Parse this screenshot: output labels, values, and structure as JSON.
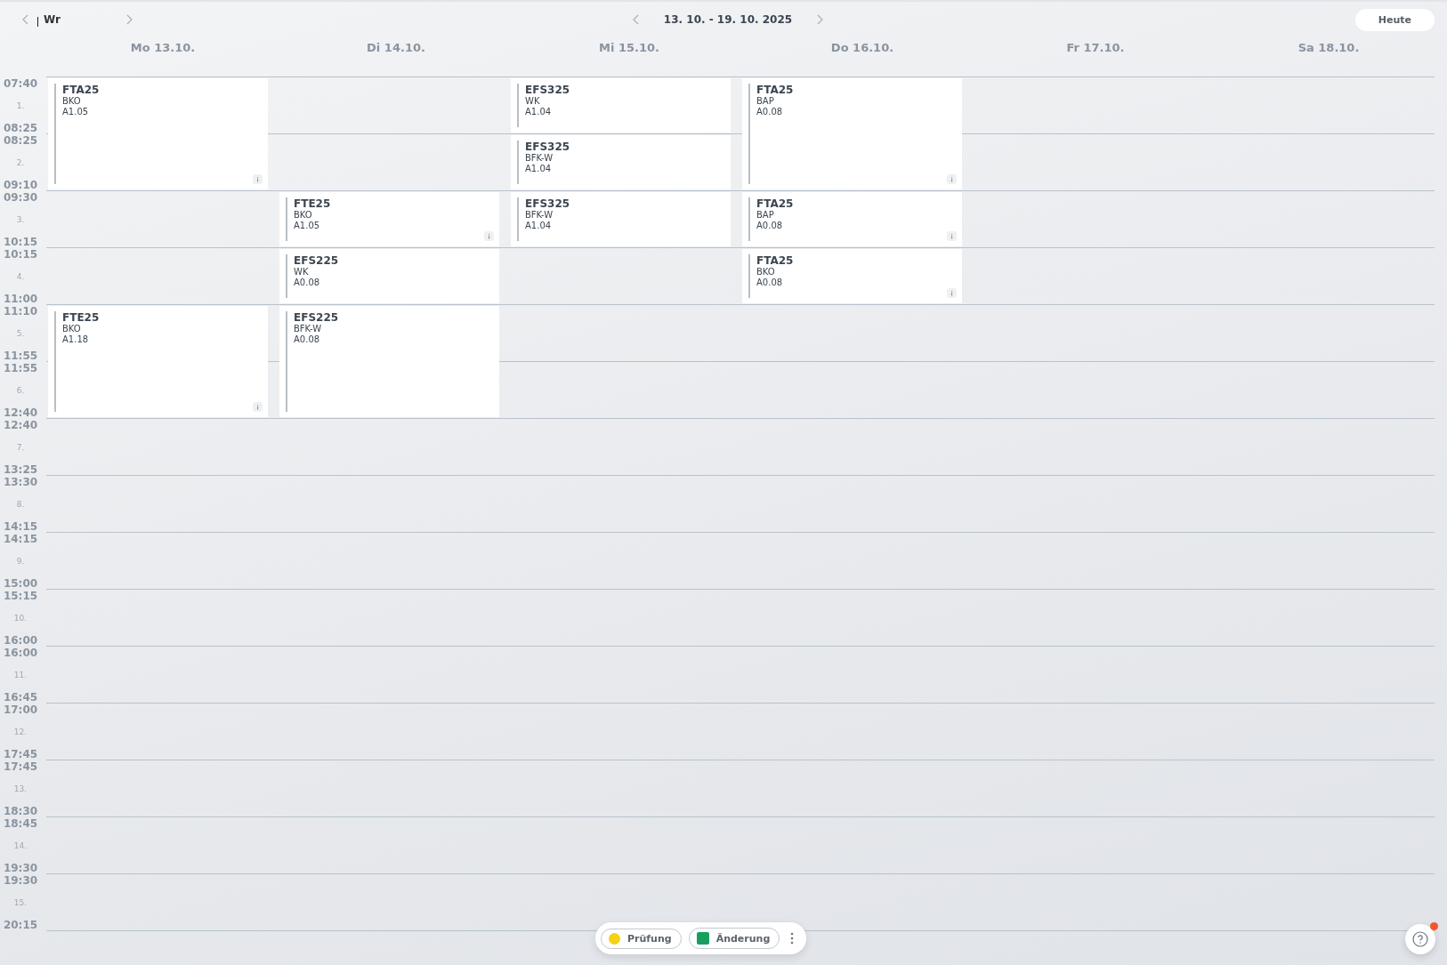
{
  "toolbar": {
    "search": {
      "value": "Wr"
    },
    "week_range": "13. 10. - 19. 10. 2025",
    "today_button": "Heute"
  },
  "time_slots": [
    {
      "number": "1.",
      "start": "07:40",
      "end": "08:25"
    },
    {
      "number": "2.",
      "start": "08:25",
      "end": "09:10"
    },
    {
      "number": "3.",
      "start": "09:30",
      "end": "10:15"
    },
    {
      "number": "4.",
      "start": "10:15",
      "end": "11:00"
    },
    {
      "number": "5.",
      "start": "11:10",
      "end": "11:55"
    },
    {
      "number": "6.",
      "start": "11:55",
      "end": "12:40"
    },
    {
      "number": "7.",
      "start": "12:40",
      "end": "13:25"
    },
    {
      "number": "8.",
      "start": "13:30",
      "end": "14:15"
    },
    {
      "number": "9.",
      "start": "14:15",
      "end": "15:00"
    },
    {
      "number": "10.",
      "start": "15:15",
      "end": "16:00"
    },
    {
      "number": "11.",
      "start": "16:00",
      "end": "16:45"
    },
    {
      "number": "12.",
      "start": "17:00",
      "end": "17:45"
    },
    {
      "number": "13.",
      "start": "17:45",
      "end": "18:30"
    },
    {
      "number": "14.",
      "start": "18:45",
      "end": "19:30"
    },
    {
      "number": "15.",
      "start": "19:30",
      "end": "20:15"
    }
  ],
  "days": [
    {
      "label": "Mo 13.10.",
      "schedule": [
        {
          "kind": "lesson",
          "class": "FTA25",
          "subject": "BKO",
          "room": "A1.05",
          "double": true,
          "has_info": true
        },
        {
          "kind": "free"
        },
        {
          "kind": "free"
        },
        {
          "kind": "lesson",
          "class": "FTE25",
          "subject": "BKO",
          "room": "A1.18",
          "double": true,
          "has_info": true
        }
      ]
    },
    {
      "label": "Di 14.10.",
      "schedule": [
        {
          "kind": "free"
        },
        {
          "kind": "free"
        },
        {
          "kind": "lesson",
          "class": "FTE25",
          "subject": "BKO",
          "room": "A1.05",
          "double": false,
          "has_info": true
        },
        {
          "kind": "lesson",
          "class": "EFS225",
          "subject": "WK",
          "room": "A0.08",
          "double": false,
          "has_info": false
        },
        {
          "kind": "lesson",
          "class": "EFS225",
          "subject": "BFK-W",
          "room": "A0.08",
          "double": true,
          "has_info": false
        }
      ]
    },
    {
      "label": "Mi 15.10.",
      "schedule": [
        {
          "kind": "lesson",
          "class": "EFS325",
          "subject": "WK",
          "room": "A1.04",
          "double": false,
          "has_info": false
        },
        {
          "kind": "lesson",
          "class": "EFS325",
          "subject": "BFK-W",
          "room": "A1.04",
          "double": false,
          "has_info": false
        },
        {
          "kind": "lesson",
          "class": "EFS325",
          "subject": "BFK-W",
          "room": "A1.04",
          "double": false,
          "has_info": false
        }
      ]
    },
    {
      "label": "Do 16.10.",
      "schedule": [
        {
          "kind": "lesson",
          "class": "FTA25",
          "subject": "BAP",
          "room": "A0.08",
          "double": true,
          "has_info": true
        },
        {
          "kind": "lesson",
          "class": "FTA25",
          "subject": "BAP",
          "room": "A0.08",
          "double": false,
          "has_info": true
        },
        {
          "kind": "lesson",
          "class": "FTA25",
          "subject": "BKO",
          "room": "A0.08",
          "double": false,
          "has_info": true
        }
      ]
    },
    {
      "label": "Fr 17.10."
    },
    {
      "label": "Sa 18.10."
    }
  ],
  "legend": [
    {
      "label": "Prüfung",
      "kind": "circle",
      "color": "#f7d114"
    },
    {
      "label": "Änderung",
      "kind": "square",
      "color": "#17a05d"
    }
  ],
  "help": {
    "notification": true
  }
}
